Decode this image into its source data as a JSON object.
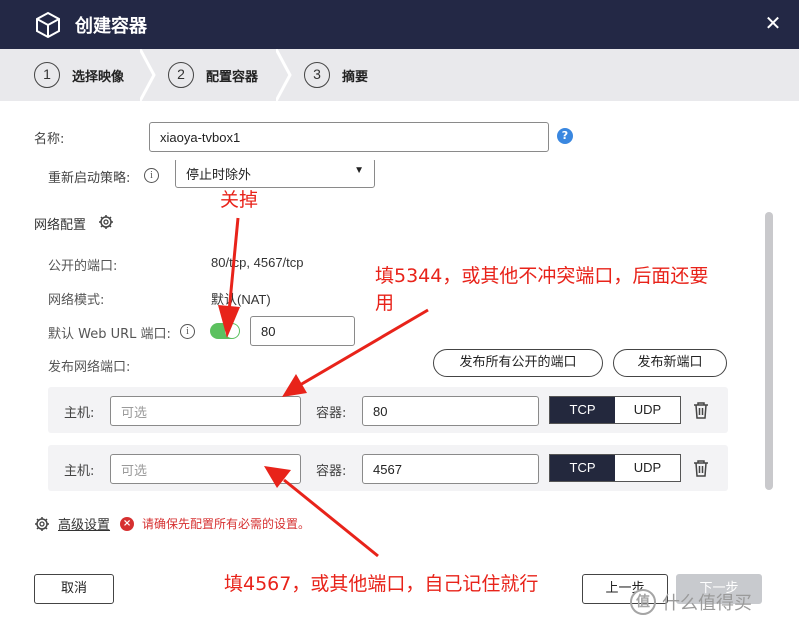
{
  "dialog": {
    "title": "创建容器",
    "close_icon": "close-icon"
  },
  "steps": [
    {
      "num": "1",
      "label": "选择映像"
    },
    {
      "num": "2",
      "label": "配置容器"
    },
    {
      "num": "3",
      "label": "摘要"
    }
  ],
  "form": {
    "name_label": "名称:",
    "name_value": "xiaoya-tvbox1",
    "help_glyph": "?",
    "restart_label": "重新启动策略:",
    "restart_value": "停止时除外",
    "info_glyph": "i"
  },
  "network": {
    "section_title": "网络配置",
    "public_ports_label": "公开的端口:",
    "public_ports_value": "80/tcp, 4567/tcp",
    "mode_label": "网络模式:",
    "mode_value": "默认(NAT)",
    "web_url_label": "默认 Web URL 端口:",
    "web_url_toggle_on": true,
    "web_url_port": "80",
    "publish_label": "发布网络端口:",
    "publish_all_button": "发布所有公开的端口",
    "publish_new_button": "发布新端口"
  },
  "port_rows": [
    {
      "host_label": "主机:",
      "host_placeholder": "可选",
      "container_label": "容器:",
      "container_value": "80",
      "tcp": "TCP",
      "udp": "UDP",
      "selected": "TCP"
    },
    {
      "host_label": "主机:",
      "host_placeholder": "可选",
      "container_label": "容器:",
      "container_value": "4567",
      "tcp": "TCP",
      "udp": "UDP",
      "selected": "TCP"
    }
  ],
  "advanced": {
    "link": "高级设置",
    "error_glyph": "×",
    "error_text": "请确保先配置所有必需的设置。"
  },
  "footer": {
    "cancel": "取消",
    "prev": "上一步",
    "next": "下一步"
  },
  "annotations": {
    "toggle_note": "关掉",
    "host_note_1": "填5344，或其他不冲突端口，后面还要",
    "host_note_2": "用",
    "host_note_bottom": "填4567，或其他端口，自己记住就行"
  },
  "watermark": {
    "badge": "值",
    "text": "什么值得买"
  },
  "colors": {
    "titlebar": "#232845",
    "annotation": "#e8231a",
    "toggle_on": "#5cc15f",
    "segment_on": "#23283d",
    "help": "#3a87e0",
    "error": "#d63030"
  }
}
